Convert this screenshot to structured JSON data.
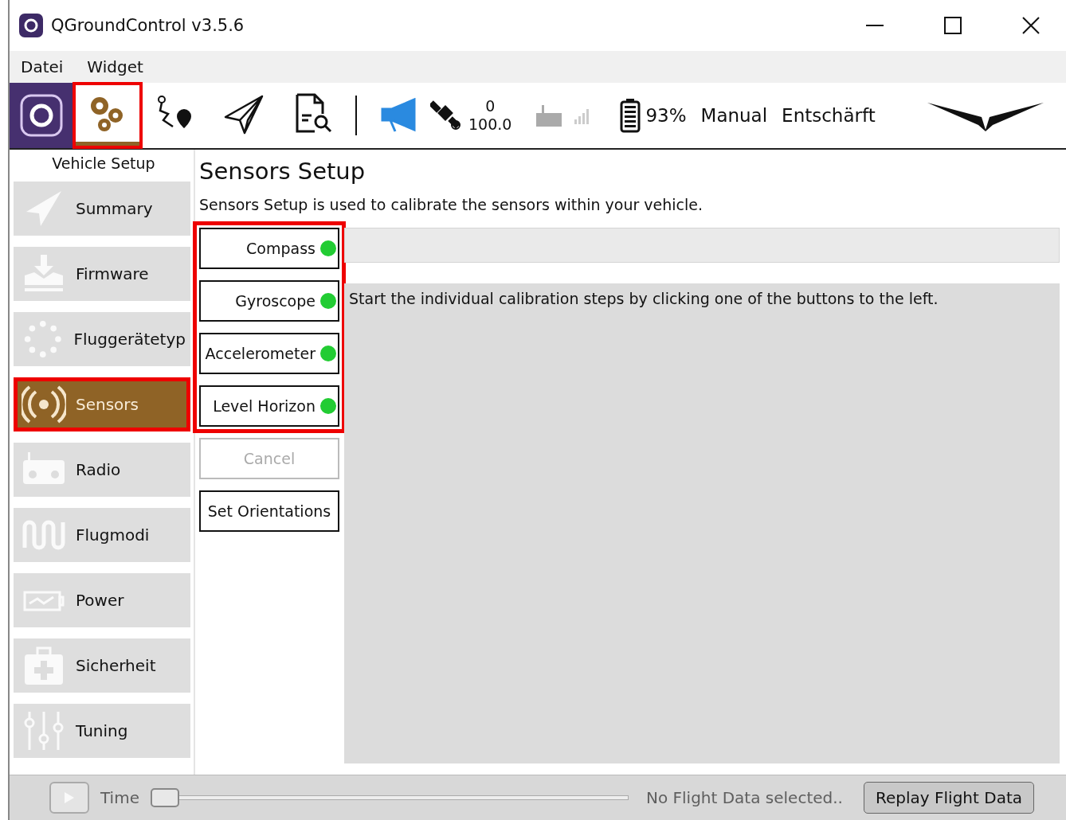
{
  "window": {
    "title": "QGroundControl v3.5.6"
  },
  "menu": [
    "Datei",
    "Widget"
  ],
  "toolbar": {
    "tools": [
      {
        "kind": "gears",
        "selected": true,
        "annotated": true
      },
      {
        "kind": "route",
        "selected": false,
        "annotated": false
      },
      {
        "kind": "plane",
        "selected": false,
        "annotated": false
      },
      {
        "kind": "log",
        "selected": false,
        "annotated": false
      }
    ],
    "gps_count": "0",
    "gps_hdop": "100.0",
    "battery": "93%",
    "flight_mode": "Manual",
    "arm_state": "Entschärft"
  },
  "sidebar": {
    "title": "Vehicle Setup",
    "items": [
      {
        "label": "Summary",
        "kind": "plane",
        "selected": false,
        "annotated": false
      },
      {
        "label": "Firmware",
        "kind": "download",
        "selected": false,
        "annotated": false
      },
      {
        "label": "Fluggerätetyp",
        "kind": "dots",
        "selected": false,
        "annotated": false
      },
      {
        "label": "Sensors",
        "kind": "signal",
        "selected": true,
        "annotated": true
      },
      {
        "label": "Radio",
        "kind": "radio",
        "selected": false,
        "annotated": false
      },
      {
        "label": "Flugmodi",
        "kind": "wave",
        "selected": false,
        "annotated": false
      },
      {
        "label": "Power",
        "kind": "battery",
        "selected": false,
        "annotated": false
      },
      {
        "label": "Sicherheit",
        "kind": "medkit",
        "selected": false,
        "annotated": false
      },
      {
        "label": "Tuning",
        "kind": "sliders",
        "selected": false,
        "annotated": false
      }
    ]
  },
  "page": {
    "title": "Sensors Setup",
    "description": "Sensors Setup is used to calibrate the sensors within your vehicle.",
    "sensors_annotated": true,
    "sensors": [
      {
        "label": "Compass",
        "done": true
      },
      {
        "label": "Gyroscope",
        "done": true
      },
      {
        "label": "Accelerometer",
        "done": true
      },
      {
        "label": "Level Horizon",
        "done": true
      }
    ],
    "cancel": {
      "label": "Cancel",
      "disabled": true
    },
    "orientations": {
      "label": "Set Orientations"
    },
    "instructions": "Start the individual calibration steps by clicking one of the buttons to the left."
  },
  "replay_bar": {
    "time_label": "Time",
    "slider": {
      "level": 0
    },
    "status": "No Flight Data selected..",
    "button": "Replay Flight Data"
  }
}
